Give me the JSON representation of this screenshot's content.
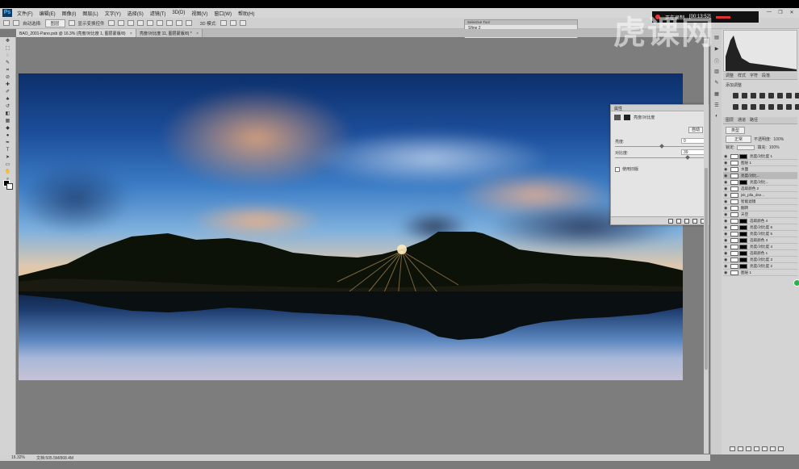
{
  "app": {
    "logo": "Ps",
    "window_controls": [
      "—",
      "❐",
      "✕"
    ]
  },
  "menu": [
    "文件(F)",
    "编辑(E)",
    "图像(I)",
    "图层(L)",
    "文字(Y)",
    "选择(S)",
    "滤镜(T)",
    "3D(D)",
    "视图(V)",
    "窗口(W)",
    "帮助(H)"
  ],
  "options_bar": {
    "auto_select": "自动选择:",
    "target": "图层",
    "show_transform": "显示变换控件",
    "mode_3d": "3D 模式:"
  },
  "recording": {
    "label": "正在录制",
    "time": "[00:13:52]"
  },
  "watermark": "虎课网",
  "doc_tabs": [
    {
      "label": "BAO_2001-Pano.psb @ 16.3% (亮度/对比度 1, 图层蒙版/8)"
    },
    {
      "label": "亮度/对比度 11, 图层蒙版/8) *"
    }
  ],
  "selective_tool": {
    "title": "Selective Tool",
    "line1": "Sfine 2",
    "line2": "%fine 2",
    "line3": "% 设置"
  },
  "properties": {
    "title": "属性",
    "subtitle": "亮度/对比度",
    "auto_button": "自动",
    "brightness_label": "亮度:",
    "brightness_value": "0",
    "contrast_label": "对比度:",
    "contrast_value": "39",
    "legacy_label": "使用旧版"
  },
  "right_panel": {
    "tabs1": [
      "调整",
      "样式",
      "字符",
      "段落"
    ],
    "adjust_title": "添加调整",
    "tabs2": [
      "图层",
      "通道",
      "路径"
    ],
    "filter_kind": "类型",
    "blend_mode": "正常",
    "opacity_label": "不透明度:",
    "opacity_value": "100%",
    "lock_label": "锁定:",
    "fill_label": "填充:",
    "fill_value": "100%"
  },
  "layers": [
    {
      "name": "亮度/对比度 1",
      "mask": true,
      "sel": false
    },
    {
      "name": "图层 1",
      "mask": false,
      "sel": false
    },
    {
      "name": "水面",
      "mask": false,
      "sel": false
    },
    {
      "name": "亮度/对比...",
      "mask": false,
      "sel": true
    },
    {
      "name": "亮度/对比...",
      "mask": true,
      "sel": false
    },
    {
      "name": "选取颜色 2",
      "mask": false,
      "sel": false
    },
    {
      "name": "jsk_plla_dse...",
      "mask": false,
      "sel": false
    },
    {
      "name": "智能滤镜",
      "mask": false,
      "sel": false
    },
    {
      "name": "翻转",
      "mask": false,
      "sel": false
    },
    {
      "name": "天空",
      "mask": false,
      "sel": false
    },
    {
      "name": "选取颜色 4",
      "mask": true,
      "sel": false
    },
    {
      "name": "亮度/对比度 6",
      "mask": true,
      "sel": false
    },
    {
      "name": "亮度/对比度 5",
      "mask": true,
      "sel": false
    },
    {
      "name": "选取颜色 3",
      "mask": true,
      "sel": false
    },
    {
      "name": "亮度/对比度 4",
      "mask": true,
      "sel": false
    },
    {
      "name": "选取颜色 1",
      "mask": true,
      "sel": false
    },
    {
      "name": "亮度/对比度 3",
      "mask": true,
      "sel": false
    },
    {
      "name": "亮度/对比度 2",
      "mask": true,
      "sel": false
    },
    {
      "name": "图层 1",
      "mask": false,
      "sel": false
    }
  ],
  "status": {
    "zoom": "16.32%",
    "doc": "文档:505.5M/868.4M"
  }
}
